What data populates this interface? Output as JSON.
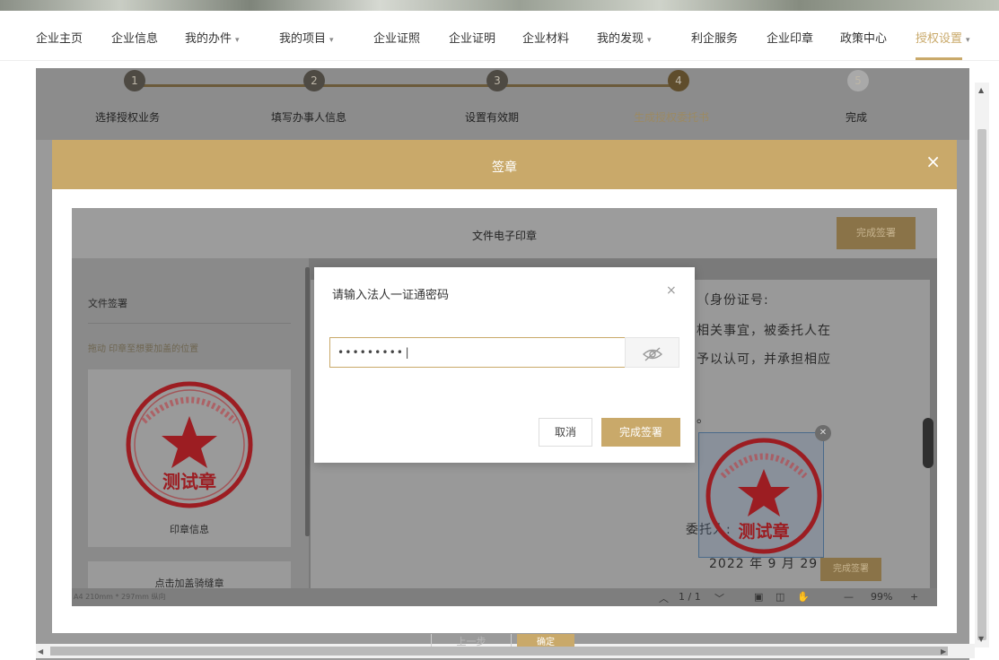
{
  "nav": {
    "items": [
      {
        "label": "企业主页",
        "dropdown": false
      },
      {
        "label": "企业信息",
        "dropdown": false
      },
      {
        "label": "我的办件",
        "dropdown": true
      },
      {
        "label": "我的项目",
        "dropdown": true
      },
      {
        "label": "企业证照",
        "dropdown": false
      },
      {
        "label": "企业证明",
        "dropdown": false
      },
      {
        "label": "企业材料",
        "dropdown": false
      },
      {
        "label": "我的发现",
        "dropdown": true
      },
      {
        "label": "利企服务",
        "dropdown": false
      },
      {
        "label": "企业印章",
        "dropdown": false
      },
      {
        "label": "政策中心",
        "dropdown": false
      },
      {
        "label": "授权设置",
        "dropdown": true,
        "active": true
      }
    ],
    "caret": "▾",
    "accent_color": "#c9a96a"
  },
  "steps": [
    {
      "num": "1",
      "label": "选择授权业务"
    },
    {
      "num": "2",
      "label": "填写办事人信息"
    },
    {
      "num": "3",
      "label": "设置有效期"
    },
    {
      "num": "4",
      "label": "生成授权委托书",
      "current": true
    },
    {
      "num": "5",
      "label": "完成"
    }
  ],
  "modal": {
    "title": "签章",
    "close_glyph": "×"
  },
  "viewer": {
    "title": "文件电子印章",
    "finish_label": "完成签署",
    "sidebar": {
      "title": "文件签署",
      "hint": "拖动 印章至想要加盖的位置",
      "seal_text": "测试章",
      "seal_caption": "印章信息",
      "riding_seal_caption": "点击加盖骑缝章"
    },
    "document": {
      "lines": [
        "（身份证号:",
        "相关事宜，被委托人在",
        "予以认可，并承担相应",
        "。"
      ],
      "principal_label": "委托人:",
      "seal_text": "测试章",
      "date": "2022  年  9  月  29",
      "finish_label": "完成签署"
    },
    "status": {
      "page_size": "A4 210mm * 297mm 纵向",
      "page_indicator": "1 / 1",
      "zoom": "99%",
      "zoom_out": "—",
      "zoom_in": "+"
    }
  },
  "dialog": {
    "title": "请输入法人一证通密码",
    "close_glyph": "×",
    "password_value": "•••••••••|",
    "eye_icon": "eye-off-icon",
    "cancel_label": "取消",
    "confirm_label": "完成签署"
  },
  "footer": {
    "prev_label": "上一步",
    "next_label": "确定"
  },
  "colors": {
    "gold": "#c9a96a",
    "seal_red": "#c8202a"
  }
}
